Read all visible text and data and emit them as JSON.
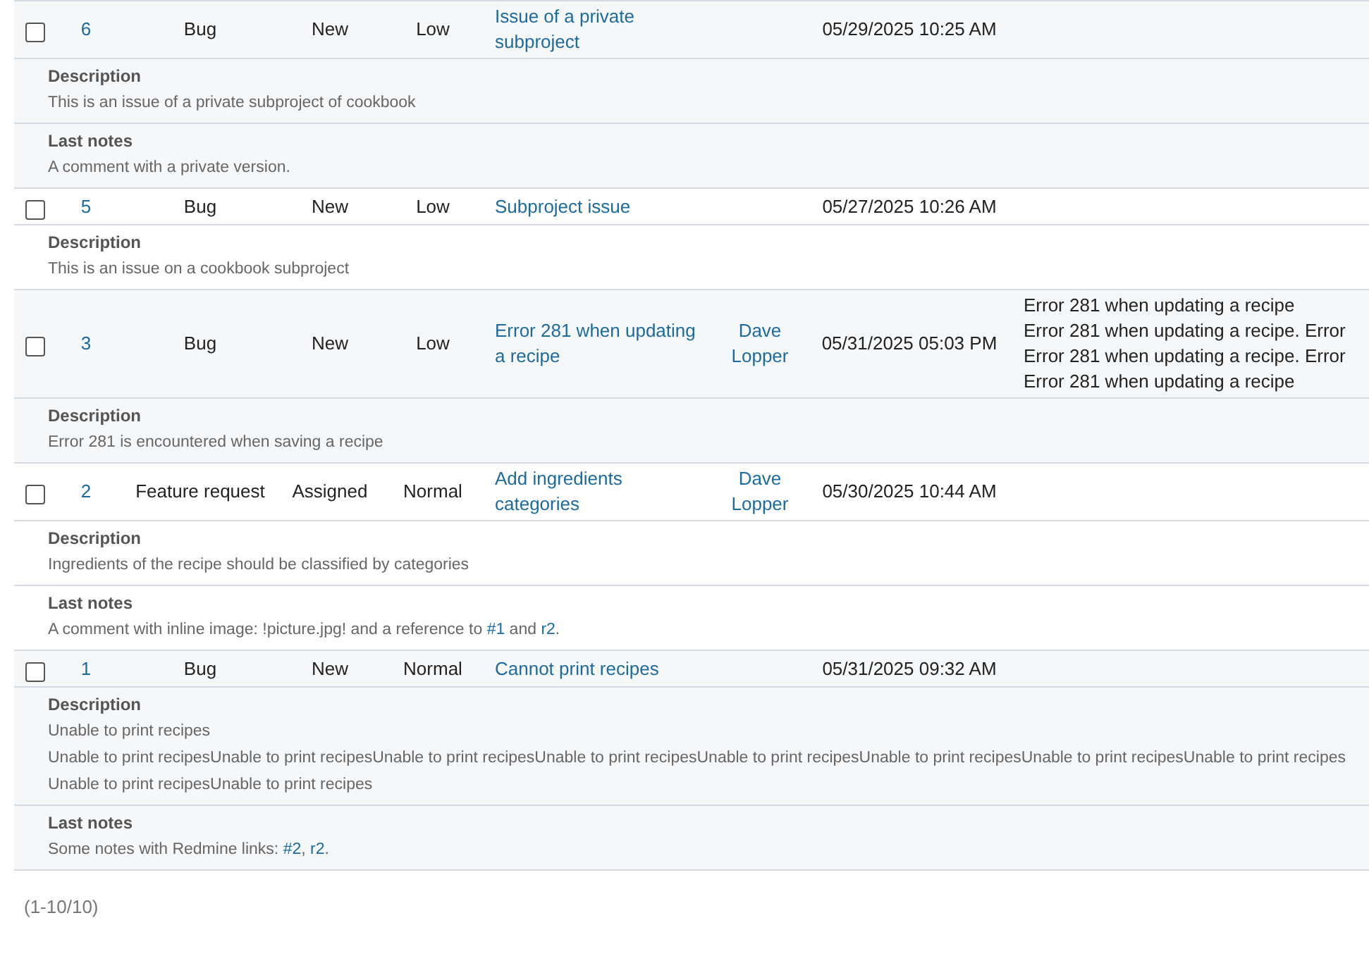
{
  "issues": [
    {
      "id": "6",
      "checked": false,
      "tracker": "Bug",
      "status": "New",
      "priority": "Low",
      "subject": "Issue of a private subproject",
      "updated": "05/29/2025 10:25 AM",
      "details": [
        {
          "label": "Description",
          "lines": [
            [
              {
                "kind": "text",
                "text": "This is an issue of a private subproject of cookbook"
              }
            ]
          ]
        },
        {
          "label": "Last notes",
          "lines": [
            [
              {
                "kind": "text",
                "text": "A comment with a private version."
              }
            ]
          ]
        }
      ]
    },
    {
      "id": "5",
      "checked": false,
      "tracker": "Bug",
      "status": "New",
      "priority": "Low",
      "subject": "Subproject issue",
      "updated": "05/27/2025 10:26 AM",
      "details": [
        {
          "label": "Description",
          "lines": [
            [
              {
                "kind": "text",
                "text": "This is an issue on a cookbook subproject"
              }
            ]
          ]
        }
      ]
    },
    {
      "id": "3",
      "checked": false,
      "tracker": "Bug",
      "status": "New",
      "priority": "Low",
      "subject": "Error 281 when updating a recipe",
      "assignee": "Dave Lopper",
      "updated": "05/31/2025 05:03 PM",
      "extra": [
        "Error 281 when updating a recipe",
        "Error 281 when updating a recipe. Error",
        "Error 281 when updating a recipe. Error",
        "Error 281 when updating a recipe"
      ],
      "details": [
        {
          "label": "Description",
          "lines": [
            [
              {
                "kind": "text",
                "text": "Error 281 is encountered when saving a recipe"
              }
            ]
          ]
        }
      ]
    },
    {
      "id": "2",
      "checked": false,
      "tracker": "Feature request",
      "status": "Assigned",
      "priority": "Normal",
      "subject": "Add ingredients categories",
      "assignee": "Dave Lopper",
      "updated": "05/30/2025 10:44 AM",
      "details": [
        {
          "label": "Description",
          "lines": [
            [
              {
                "kind": "text",
                "text": "Ingredients of the recipe should be classified by categories"
              }
            ]
          ]
        },
        {
          "label": "Last notes",
          "lines": [
            [
              {
                "kind": "text",
                "text": "A comment with inline image: !picture.jpg! and a reference to "
              },
              {
                "kind": "link",
                "text": "#1"
              },
              {
                "kind": "text",
                "text": " and "
              },
              {
                "kind": "link",
                "text": "r2"
              },
              {
                "kind": "text",
                "text": "."
              }
            ]
          ]
        }
      ]
    },
    {
      "id": "1",
      "checked": false,
      "tracker": "Bug",
      "status": "New",
      "priority": "Normal",
      "subject": "Cannot print recipes",
      "updated": "05/31/2025 09:32 AM",
      "details": [
        {
          "label": "Description",
          "lines": [
            [
              {
                "kind": "text",
                "text": "Unable to print recipes"
              }
            ],
            [
              {
                "kind": "text",
                "text": "Unable to print recipesUnable to print recipesUnable to print recipesUnable to print recipesUnable to print recipesUnable to print recipesUnable to print recipesUnable to print recipes"
              }
            ],
            [
              {
                "kind": "text",
                "text": "Unable to print recipesUnable to print recipes"
              }
            ]
          ]
        },
        {
          "label": "Last notes",
          "lines": [
            [
              {
                "kind": "text",
                "text": "Some notes with Redmine links: "
              },
              {
                "kind": "link",
                "text": "#2"
              },
              {
                "kind": "text",
                "text": ", "
              },
              {
                "kind": "link",
                "text": "r2"
              },
              {
                "kind": "text",
                "text": "."
              }
            ]
          ]
        }
      ]
    }
  ],
  "pagination": "(1-10/10)"
}
